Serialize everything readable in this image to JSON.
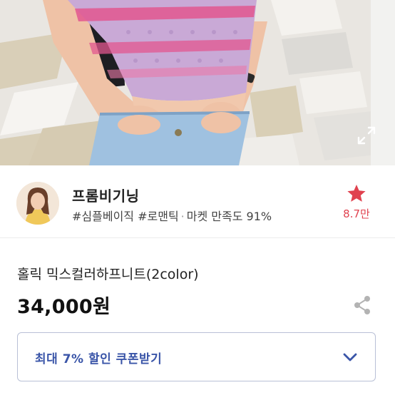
{
  "seller": {
    "name": "프롬비기닝",
    "tag_line": "#심플베이직 #로맨틱",
    "separator": "·",
    "satisfaction": "마켓 만족도 91%",
    "favorite_count": "8.7만"
  },
  "product": {
    "name": "홀릭 믹스컬러하프니트(2color)",
    "price": "34,000원"
  },
  "coupon": {
    "label": "최대 7% 할인 쿠폰받기"
  },
  "colors": {
    "accent_red": "#e0424f",
    "coupon_blue": "#3a55a8",
    "coupon_border": "#b9c0d6"
  },
  "icons": {
    "expand": "expand-icon",
    "favorite": "star-icon",
    "share": "share-icon",
    "coupon": "chevron-down-icon"
  }
}
